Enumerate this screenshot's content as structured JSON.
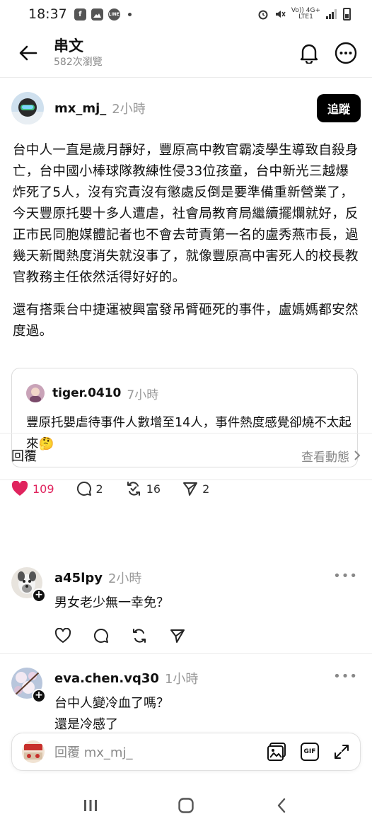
{
  "status_bar": {
    "time": "18:37",
    "left_icons": [
      "facebook-icon",
      "gallery-icon",
      "line-icon"
    ],
    "line_label": "LINE",
    "network_top": "Vo)) 4G+",
    "network_bottom": "LTE1"
  },
  "header": {
    "title": "串文",
    "view_count": "582次瀏覽"
  },
  "post": {
    "author": "mx_mj_",
    "time": "2小時",
    "follow_label": "追蹤",
    "paragraphs": [
      "台中人一直是歲月靜好，豐原高中教官霸凌學生導致自殺身亡，台中國小棒球隊教練性侵33位孩童，台中新光三越爆炸死了5人，沒有究責沒有懲處反倒是要準備重新營業了，今天豐原托嬰十多人遭虐，社會局教育局繼續擺爛就好，反正市民同胞媒體記者也不會去苛責第一名的盧秀燕市長，過幾天新聞熱度消失就沒事了，就像豐原高中害死人的校長教官教務主任依然活得好好的。",
      "還有搭乘台中捷運被興富發吊臂砸死的事件，盧媽媽都安然度過。"
    ],
    "quote": {
      "author": "tiger.0410",
      "time": "7小時",
      "text": "豐原托嬰虐待事件人數增至14人，事件熱度感覺卻燒不太起來🤔"
    },
    "stats": {
      "likes": "109",
      "replies": "2",
      "reposts": "16",
      "shares": "2"
    },
    "accent_like": "#e0245e"
  },
  "replies_section": {
    "title": "回覆",
    "view_activity": "查看動態"
  },
  "replies": [
    {
      "author": "a45lpy",
      "time": "2小時",
      "lines": [
        "男女老少無一幸免？"
      ]
    },
    {
      "author": "eva.chen.vq30",
      "time": "1小時",
      "lines": [
        "台中人變冷血了嗎？",
        "還是冷感了"
      ]
    }
  ],
  "composer": {
    "placeholder": "回覆 mx_mj_",
    "gif_label": "GIF"
  }
}
